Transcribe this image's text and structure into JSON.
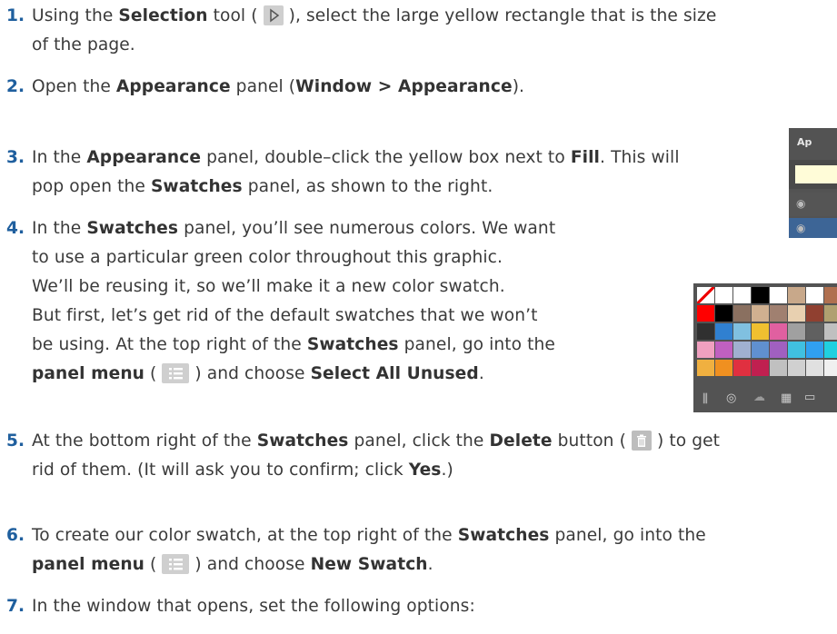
{
  "steps": [
    {
      "num": "1.",
      "l1a": "Using the ",
      "l1b": "Selection",
      "l1c": " tool ( ",
      "l1d": " ), select the large yellow rectangle that is the size",
      "l2": "of the page."
    },
    {
      "num": "2.",
      "l1a": "Open the ",
      "l1b": "Appearance",
      "l1c": " panel (",
      "l1d": "Window > Appearance",
      "l1e": ")."
    },
    {
      "num": "3.",
      "l1a": "In the ",
      "l1b": "Appearance",
      "l1c": " panel, double–click the yellow box next to ",
      "l1d": "Fill",
      "l1e": ". This will",
      "l2a": "pop open the ",
      "l2b": "Swatches",
      "l2c": " panel, as shown to the right."
    },
    {
      "num": "4.",
      "l1a": "In the ",
      "l1b": "Swatches",
      "l1c": " panel, you’ll see numerous colors. We want",
      "l2": "to use a particular green color throughout this graphic.",
      "l3": "We’ll be reusing it, so we’ll make it a new color swatch.",
      "l4": "But first, let’s get rid of the default swatches that we won’t",
      "l5a": "be using. At the top right of the ",
      "l5b": "Swatches",
      "l5c": " panel, go into the",
      "l6a": "panel menu",
      "l6b": " ( ",
      "l6c": " ) and choose ",
      "l6d": "Select All Unused",
      "l6e": "."
    },
    {
      "num": "5.",
      "l1a": "At the bottom right of the ",
      "l1b": "Swatches",
      "l1c": " panel, click the ",
      "l1d": "Delete",
      "l1e": " button ( ",
      "l1f": " ) to get",
      "l2a": "rid of them. (It will ask you to confirm; click ",
      "l2b": "Yes",
      "l2c": ".)"
    },
    {
      "num": "6.",
      "l1a": "To create our color swatch, at the top right of the ",
      "l1b": "Swatches",
      "l1c": " panel, go into the",
      "l2a": "panel menu",
      "l2b": " ( ",
      "l2c": " ) and choose ",
      "l2d": "New Swatch",
      "l2e": "."
    },
    {
      "num": "7.",
      "l1": "In the window that opens, set the following options:"
    }
  ],
  "appearance_panel": {
    "tab_label": "Ap",
    "fill_color": "#fffcd8"
  },
  "swatch_colors": {
    "row1": [
      "#ffffff",
      "#ffffff",
      "#ffffff",
      "#000000",
      "#ffffff",
      "#c8a88a",
      "#ffffff",
      "#b07050"
    ],
    "row2": [
      "#ff0000",
      "#000000",
      "#8a7060",
      "#d0b090",
      "#a08070",
      "#e8d0b0",
      "#904030",
      "#b0a070"
    ],
    "row3": [
      "#303030",
      "#3080d0",
      "#80c0e0",
      "#f0c030",
      "#e060a0",
      "#a0a0a0",
      "#606060",
      "#c0c0c0"
    ],
    "row4": [
      "#f0a0c0",
      "#c060c0",
      "#a0b0d0",
      "#6090d0",
      "#a060c0",
      "#40c0e0",
      "#30a0f0",
      "#20d0e0"
    ],
    "row5": [
      "#f0b040",
      "#f09020",
      "#e03040",
      "#c02050",
      "#c0c0c0",
      "#d0d0d0",
      "#e0e0e0",
      "#f0f0f0"
    ]
  },
  "colors": {
    "step_number": "#1f5f9e",
    "panel_bg": "#535353",
    "selected_row": "#3d6596"
  }
}
